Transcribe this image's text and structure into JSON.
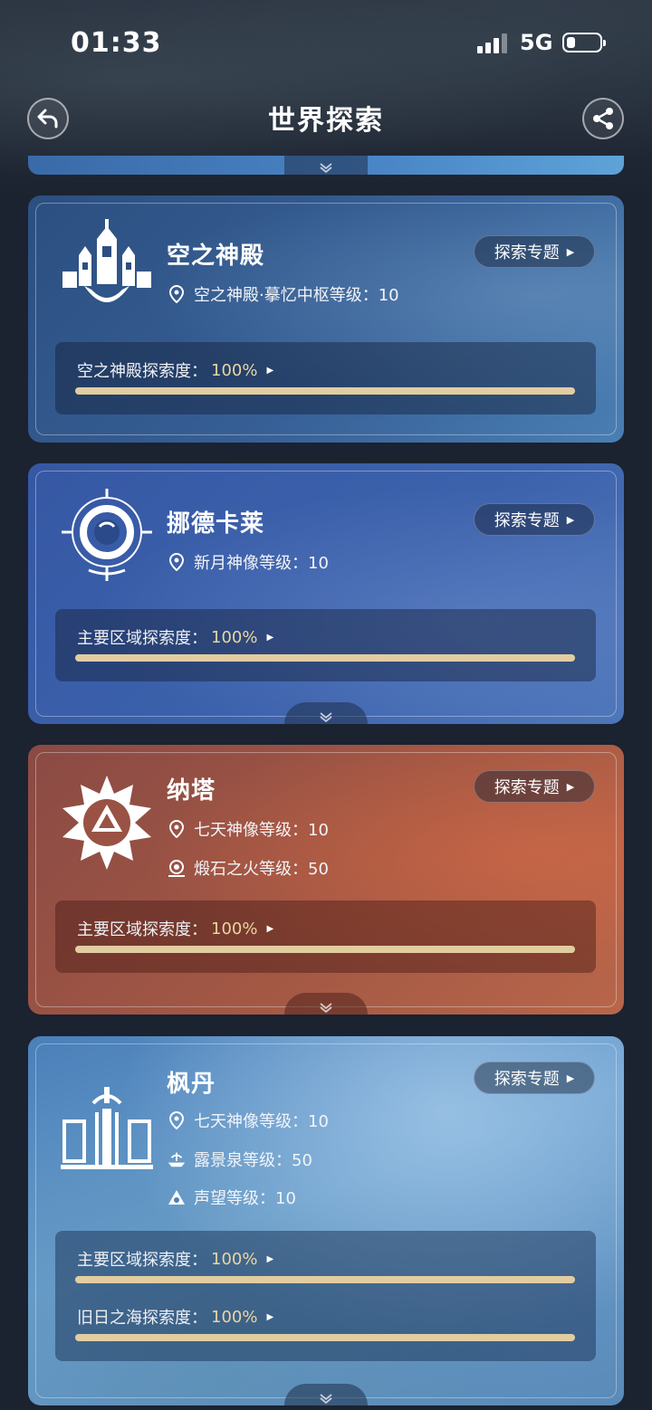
{
  "status_bar": {
    "time": "01:33",
    "network": "5G"
  },
  "header": {
    "title": "世界探索"
  },
  "regions": [
    {
      "name": "空之神殿",
      "topic_label": "探索专题",
      "infos": [
        {
          "icon": "location-pin-icon",
          "text": "空之神殿·摹忆中枢等级：10"
        }
      ],
      "progress": [
        {
          "label": "空之神殿探索度：",
          "percent": "100%",
          "value": 1.0
        }
      ]
    },
    {
      "name": "挪德卡莱",
      "topic_label": "探索专题",
      "infos": [
        {
          "icon": "location-pin-icon",
          "text": "新月神像等级：10"
        }
      ],
      "progress": [
        {
          "label": "主要区域探索度：",
          "percent": "100%",
          "value": 1.0
        }
      ]
    },
    {
      "name": "纳塔",
      "topic_label": "探索专题",
      "infos": [
        {
          "icon": "location-pin-icon",
          "text": "七天神像等级：10"
        },
        {
          "icon": "flame-stone-icon",
          "text": "煅石之火等级：50"
        }
      ],
      "progress": [
        {
          "label": "主要区域探索度：",
          "percent": "100%",
          "value": 1.0
        }
      ]
    },
    {
      "name": "枫丹",
      "topic_label": "探索专题",
      "infos": [
        {
          "icon": "location-pin-icon",
          "text": "七天神像等级：10"
        },
        {
          "icon": "fountain-icon",
          "text": "露景泉等级：50"
        },
        {
          "icon": "reputation-icon",
          "text": "声望等级：10"
        }
      ],
      "progress": [
        {
          "label": "主要区域探索度：",
          "percent": "100%",
          "value": 1.0
        },
        {
          "label": "旧日之海探索度：",
          "percent": "100%",
          "value": 1.0
        }
      ]
    }
  ],
  "colors": {
    "progress_fill": "#e2cda0",
    "percent_text": "#e9d5a2"
  }
}
